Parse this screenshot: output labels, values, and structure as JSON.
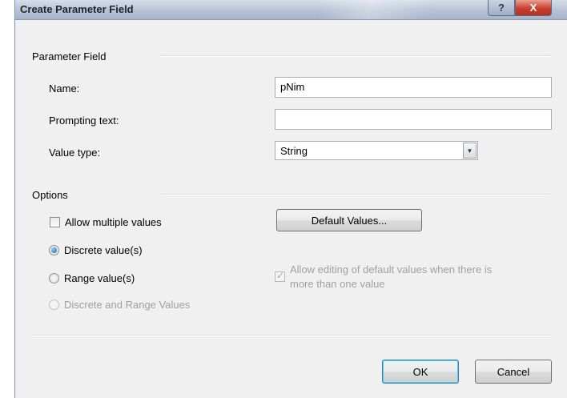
{
  "window": {
    "title": "Create Parameter Field",
    "help_glyph": "?",
    "close_glyph": "X"
  },
  "parameter_field": {
    "section_title": "Parameter Field",
    "name_label": "Name:",
    "name_value": "pNim",
    "prompting_label": "Prompting text:",
    "prompting_value": "",
    "value_type_label": "Value type:",
    "value_type_selected": "String"
  },
  "options": {
    "section_title": "Options",
    "allow_multiple_label": "Allow multiple values",
    "allow_multiple_checked": false,
    "default_values_button": "Default Values...",
    "discrete_label": "Discrete value(s)",
    "range_label": "Range value(s)",
    "discrete_and_range_label": "Discrete and Range Values",
    "selected_radio": "Discrete value(s)",
    "allow_editing_label_line1": "Allow editing of default values when there is",
    "allow_editing_label_line2": "more than one value",
    "allow_editing_checked": true
  },
  "buttons": {
    "ok": "OK",
    "cancel": "Cancel"
  },
  "icons": {
    "dropdown": "chevron-down-icon",
    "help": "help-icon",
    "close": "close-icon"
  }
}
